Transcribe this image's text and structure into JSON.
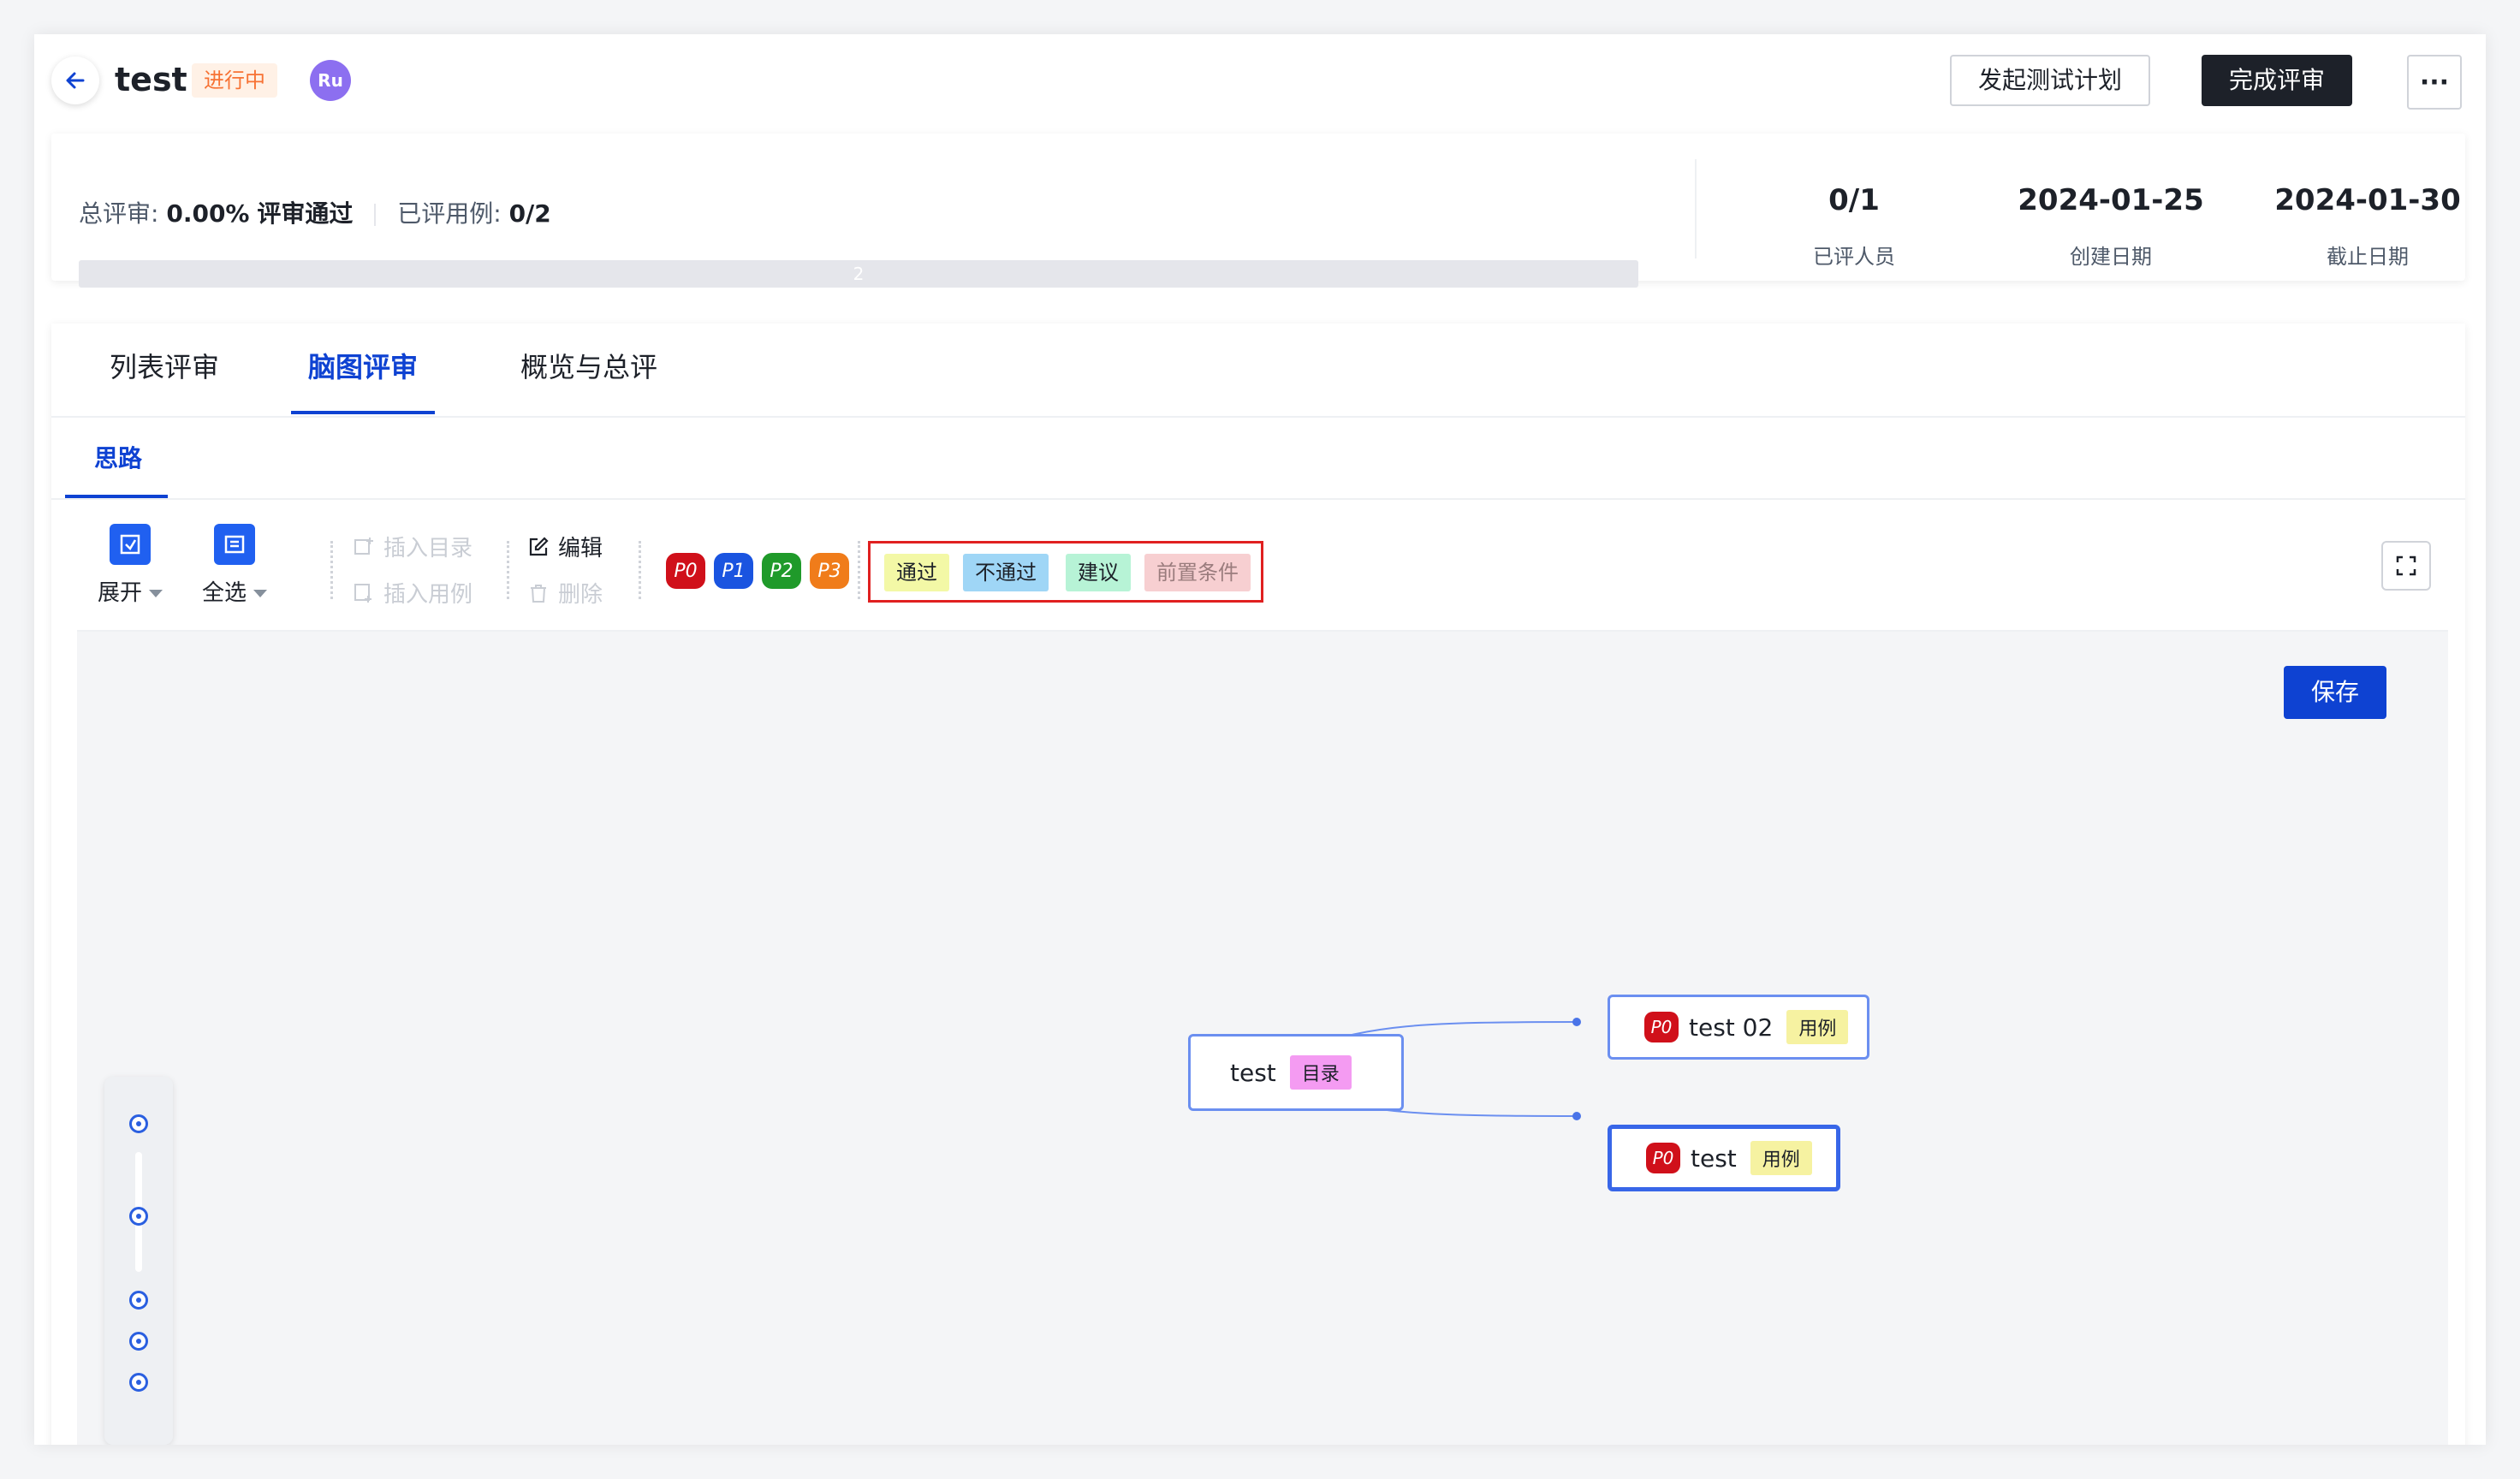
{
  "header": {
    "title": "test",
    "status": "进行中",
    "avatar": "Ru",
    "launch_plan_label": "发起测试计划",
    "complete_review_label": "完成评审",
    "more_label": "···"
  },
  "stats": {
    "overall_label": "总评审:",
    "overall_value": "0.00%",
    "pass_label": "评审通过",
    "reviewed_cases_label": "已评用例:",
    "reviewed_cases_value": "0/2",
    "progress_text": "2",
    "progress_fraction": 0.0,
    "reviewers_value": "0/1",
    "reviewers_label": "已评人员",
    "created_value": "2024-01-25",
    "created_label": "创建日期",
    "deadline_value": "2024-01-30",
    "deadline_label": "截止日期"
  },
  "tabs": [
    {
      "label": "列表评审"
    },
    {
      "label": "脑图评审"
    },
    {
      "label": "概览与总评"
    }
  ],
  "subtab": {
    "label": "思路"
  },
  "toolbar": {
    "expand_label": "展开",
    "select_all_label": "全选",
    "insert_dir_label": "插入目录",
    "insert_case_label": "插入用例",
    "edit_label": "编辑",
    "delete_label": "删除",
    "priorities": [
      "P0",
      "P1",
      "P2",
      "P3"
    ],
    "priority_colors": [
      "#d0101a",
      "#1a54e0",
      "#1f9a2a",
      "#f07c1a"
    ],
    "tags": [
      {
        "label": "通过",
        "bg": "#f3f8a6"
      },
      {
        "label": "不通过",
        "bg": "#9fd6f6"
      },
      {
        "label": "建议",
        "bg": "#b7f3d6"
      },
      {
        "label": "前置条件",
        "bg": "#f7cfd1"
      }
    ]
  },
  "canvas": {
    "save_label": "保存",
    "root": {
      "text": "test",
      "tag": "目录"
    },
    "children": [
      {
        "priority": "P0",
        "text": "test 02",
        "tag": "用例"
      },
      {
        "priority": "P0",
        "text": "test",
        "tag": "用例"
      }
    ]
  }
}
